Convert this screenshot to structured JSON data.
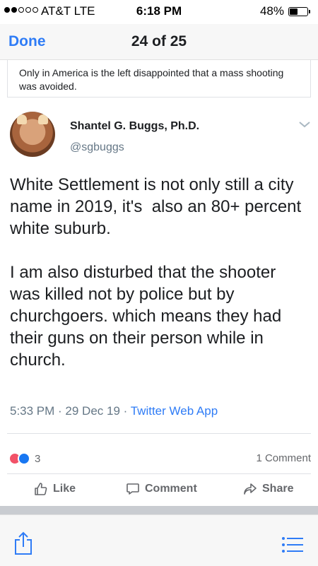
{
  "status_bar": {
    "carrier": "AT&T  LTE",
    "time": "6:18 PM",
    "battery": "48%",
    "battery_level": 0.48
  },
  "nav": {
    "done_label": "Done",
    "title": "24 of 25"
  },
  "previous_comment": {
    "text": "Only in America is the left disappointed that a mass shooting was avoided."
  },
  "tweet": {
    "display_name": "Shantel G. Buggs, Ph.D.",
    "handle": "@sgbuggs",
    "body": "White Settlement is not only still a city name in 2019, it's  also an 80+ percent white suburb.\n\nI am also disturbed that the shooter was killed not by police but by churchgoers. which means they had their guns on their person while in church.",
    "timestamp": "5:33 PM · 29 Dec 19 · ",
    "source": "Twitter Web App"
  },
  "post_footer": {
    "reaction_count": "3",
    "comments_count": "1 Comment",
    "like_label": "Like",
    "comment_label": "Comment",
    "share_label": "Share"
  },
  "colors": {
    "accent": "#2f7cf6",
    "angry": "#f25268",
    "like": "#1877f2"
  }
}
